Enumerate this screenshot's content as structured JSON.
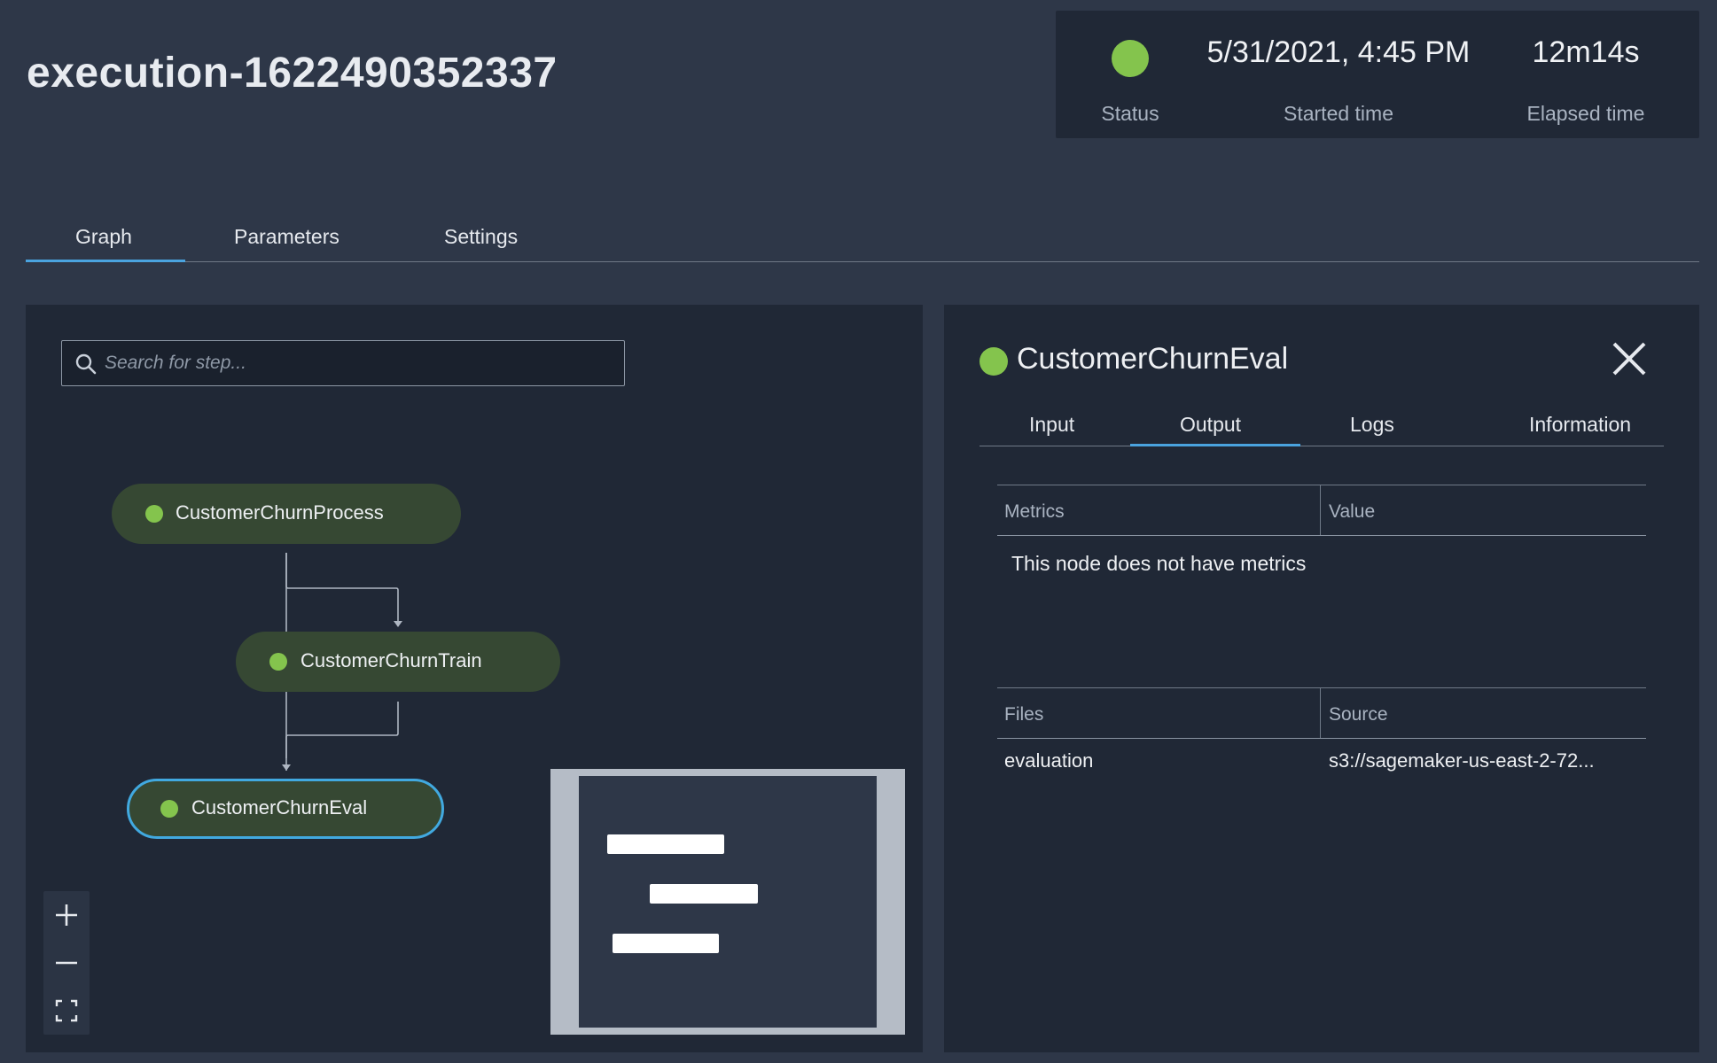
{
  "page": {
    "title": "execution-1622490352337"
  },
  "summary": {
    "status_label": "Status",
    "status_color": "#84c44d",
    "started_time": "5/31/2021, 4:45 PM",
    "started_label": "Started time",
    "elapsed_time": "12m14s",
    "elapsed_label": "Elapsed time"
  },
  "tabs": [
    {
      "label": "Graph",
      "active": true
    },
    {
      "label": "Parameters",
      "active": false
    },
    {
      "label": "Settings",
      "active": false
    }
  ],
  "graph": {
    "search": {
      "placeholder": "Search for step..."
    },
    "nodes": [
      {
        "label": "CustomerChurnProcess",
        "status": "succeeded"
      },
      {
        "label": "CustomerChurnTrain",
        "status": "succeeded"
      },
      {
        "label": "CustomerChurnEval",
        "status": "succeeded",
        "selected": true
      }
    ],
    "zoom_controls": [
      "plus-icon",
      "minus-icon",
      "fit-to-screen-icon"
    ]
  },
  "detail": {
    "title": "CustomerChurnEval",
    "status_color": "#84c44d",
    "tabs": [
      {
        "label": "Input",
        "active": false
      },
      {
        "label": "Output",
        "active": true
      },
      {
        "label": "Logs",
        "active": false
      },
      {
        "label": "Information",
        "active": false
      }
    ],
    "metrics_table": {
      "columns": [
        "Metrics",
        "Value"
      ],
      "empty_message": "This node does not have metrics"
    },
    "files_table": {
      "columns": [
        "Files",
        "Source"
      ],
      "rows": [
        {
          "file": "evaluation",
          "source": "s3://sagemaker-us-east-2-72..."
        }
      ]
    }
  },
  "colors": {
    "accent": "#4aa3df",
    "success": "#84c44d",
    "node_fill": "#364833",
    "panel_bg": "#202836",
    "page_bg": "#2e3748"
  }
}
